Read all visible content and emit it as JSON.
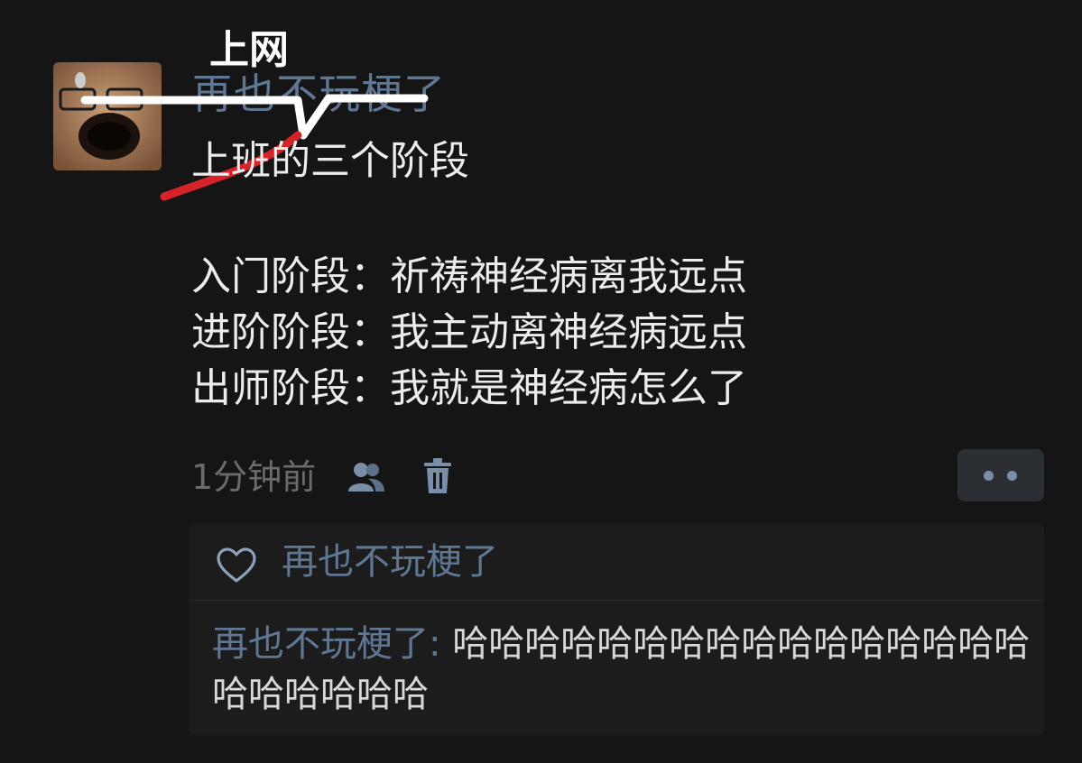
{
  "post": {
    "author": "再也不玩梗了",
    "overlay_label": "上网",
    "lines": {
      "title": "上班的三个阶段",
      "stage1": "入门阶段：祈祷神经病离我远点",
      "stage2": "进阶阶段：我主动离神经病远点",
      "stage3": "出师阶段：我就是神经病怎么了"
    },
    "timestamp": "1分钟前"
  },
  "icons": {
    "friends": "friends-visibility-icon",
    "trash": "trash-icon",
    "more": "more-dots-icon",
    "heart": "heart-icon"
  },
  "likes": {
    "name": "再也不玩梗了"
  },
  "comment": {
    "author": "再也不玩梗了",
    "separator": ": ",
    "text": "哈哈哈哈哈哈哈哈哈哈哈哈哈哈哈哈哈哈哈哈哈哈"
  },
  "colors": {
    "background": "#151515",
    "username": "#5f7793",
    "accent_red": "#d6232a",
    "comment_bg": "#1c1c1d"
  }
}
